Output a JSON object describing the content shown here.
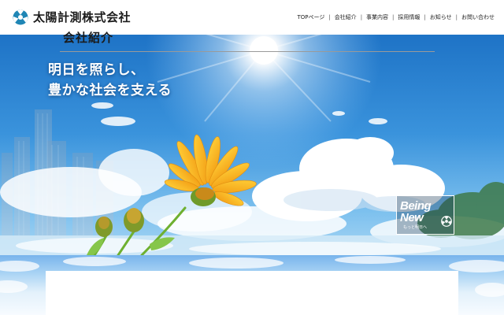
{
  "brand": {
    "name": "太陽計測株式会社",
    "accent": "#1f86b5"
  },
  "nav": {
    "items": [
      "TOPページ",
      "会社紹介",
      "事業内容",
      "採用情報",
      "お知らせ",
      "お問い合わせ"
    ],
    "separator": "|"
  },
  "hero": {
    "tagline_line1": "明日を照らし、",
    "tagline_line2": "豊かな社会を支える",
    "badge": {
      "line1": "Being",
      "line2": "New",
      "sub": "もっと明日へ"
    },
    "sky_color": "#1f7fd6"
  },
  "section": {
    "title": "会社紹介"
  }
}
